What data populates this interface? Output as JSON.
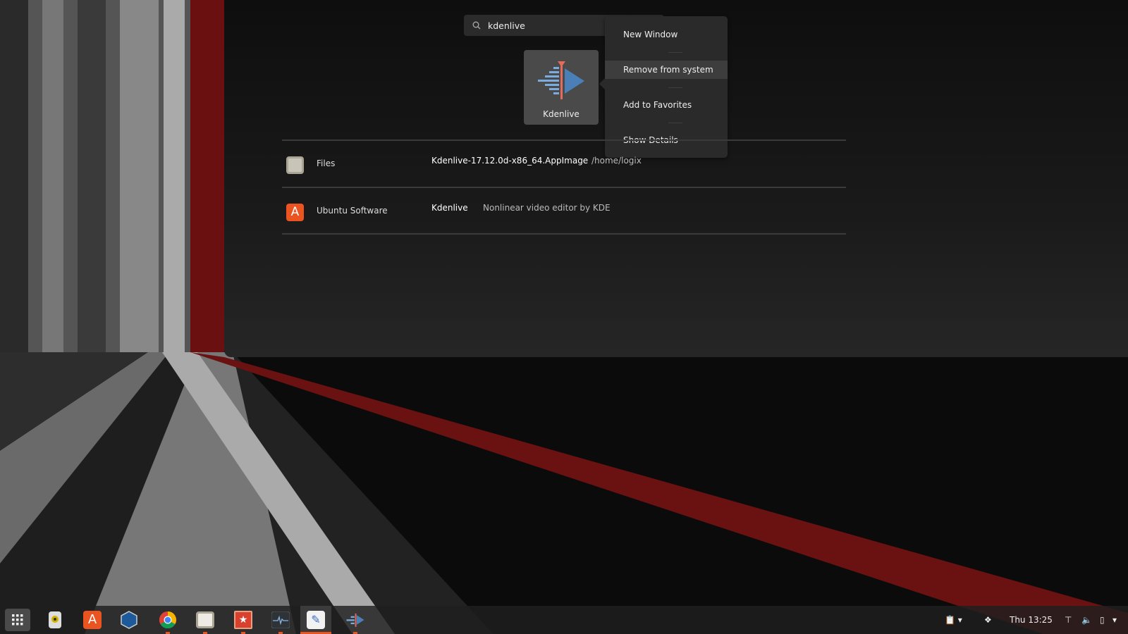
{
  "search": {
    "value": "kdenlive"
  },
  "app_tile": {
    "label": "Kdenlive"
  },
  "context_menu": {
    "items": [
      {
        "label": "New Window"
      },
      {
        "label": "Remove from system"
      },
      {
        "label": "Add to Favorites"
      },
      {
        "label": "Show Details"
      }
    ]
  },
  "results": [
    {
      "provider": "Files",
      "title": "Kdenlive-17.12.0d-x86_64.AppImage",
      "detail": "/home/logix",
      "icon": "folder-icon"
    },
    {
      "provider": "Ubuntu Software",
      "title": "Kdenlive",
      "detail": "Nonlinear video editor by KDE",
      "icon": "software-center-icon"
    }
  ],
  "dock": {
    "apps": [
      "show-apps",
      "rhythmbox",
      "ubuntu-software",
      "virtualbox",
      "chrome",
      "files",
      "wunderlist",
      "system-monitor",
      "text-editor",
      "kdenlive"
    ]
  },
  "tray": {
    "clock": "Thu 13:25"
  },
  "colors": {
    "accent": "#e95420",
    "kdenlive_blue": "#4a7fb8",
    "kdenlive_red": "#e66b5b"
  }
}
